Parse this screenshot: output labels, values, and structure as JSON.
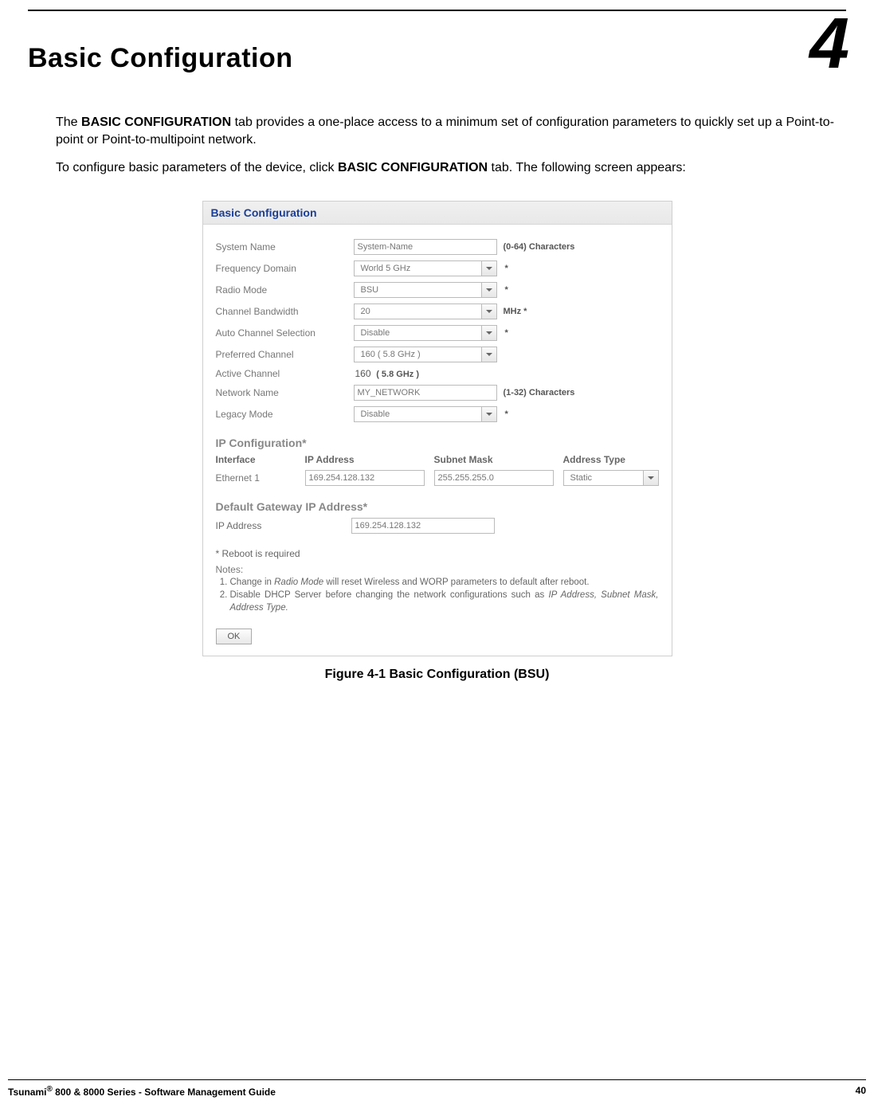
{
  "chapter_number": "4",
  "title": "Basic Configuration",
  "intro_p1_prefix": "The ",
  "intro_p1_bold": "BASIC CONFIGURATION",
  "intro_p1_suffix": " tab provides a one-place access to a minimum set of configuration parameters to quickly set up a Point-to-point or Point-to-multipoint network.",
  "intro_p2_prefix": "To configure basic parameters of the device, click ",
  "intro_p2_bold": "BASIC CONFIGURATION",
  "intro_p2_suffix": " tab. The following screen appears:",
  "panel": {
    "header": "Basic Configuration",
    "rows": {
      "system_name": {
        "label": "System Name",
        "value": "System-Name",
        "hint": "(0-64) Characters"
      },
      "freq_domain": {
        "label": "Frequency Domain",
        "value": "World 5 GHz",
        "hint": "*"
      },
      "radio_mode": {
        "label": "Radio Mode",
        "value": "BSU",
        "hint": "*"
      },
      "chan_bw": {
        "label": "Channel Bandwidth",
        "value": "20",
        "hint": "MHz *"
      },
      "auto_chan": {
        "label": "Auto Channel Selection",
        "value": "Disable",
        "hint": "*"
      },
      "pref_chan": {
        "label": "Preferred Channel",
        "value": "160 ( 5.8 GHz )",
        "hint": ""
      },
      "active_chan": {
        "label": "Active Channel",
        "value": "160",
        "paren": "( 5.8 GHz )"
      },
      "net_name": {
        "label": "Network Name",
        "value": "MY_NETWORK",
        "hint": "(1-32) Characters"
      },
      "legacy": {
        "label": "Legacy Mode",
        "value": "Disable",
        "hint": "*"
      }
    },
    "ip_section_title": "IP Configuration*",
    "ip_head": {
      "c1": "Interface",
      "c2": "IP Address",
      "c3": "Subnet Mask",
      "c4": "Address Type"
    },
    "ip_row": {
      "iface": "Ethernet 1",
      "ip": "169.254.128.132",
      "mask": "255.255.255.0",
      "type": "Static"
    },
    "gw_title": "Default Gateway IP Address*",
    "gw_row": {
      "label": "IP Address",
      "value": "169.254.128.132"
    },
    "reboot": "* Reboot is required",
    "notes_head": "Notes:",
    "note1_a": "Change in ",
    "note1_ital": "Radio Mode",
    "note1_b": " will reset Wireless and WORP parameters to default after reboot.",
    "note2_a": "Disable DHCP Server before changing the network configurations such as ",
    "note2_ital": "IP Address, Subnet Mask, Address Type.",
    "ok": "OK"
  },
  "figure_caption": "Figure 4-1 Basic Configuration (BSU)",
  "footer_left_a": "Tsunami",
  "footer_left_reg": "®",
  "footer_left_b": " 800 & 8000 Series - Software Management Guide",
  "footer_right": "40"
}
